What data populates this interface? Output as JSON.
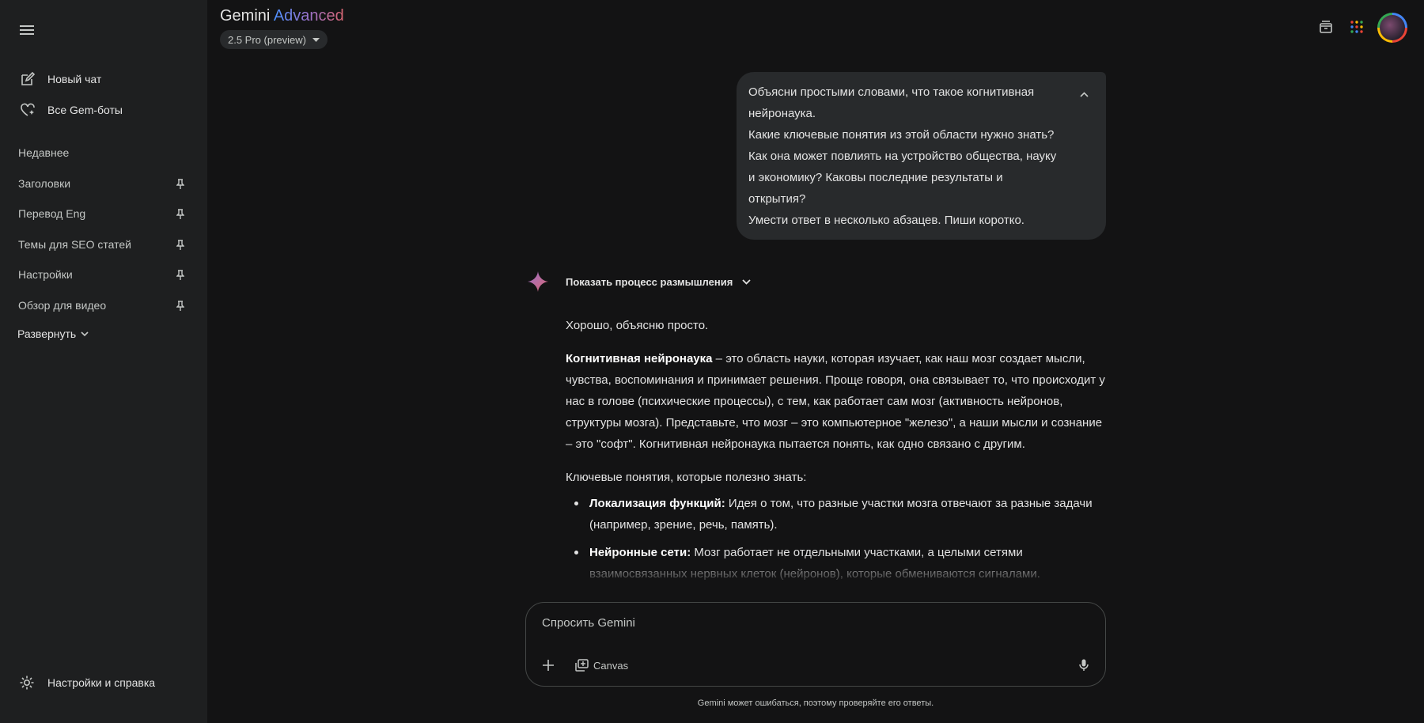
{
  "sidebar": {
    "new_chat": "Новый чат",
    "gems": "Все Gem-боты",
    "recent_label": "Недавнее",
    "recent_items": [
      {
        "label": "Заголовки"
      },
      {
        "label": "Перевод Eng"
      },
      {
        "label": "Темы для SEO статей"
      },
      {
        "label": "Настройки"
      },
      {
        "label": "Обзор для видео"
      }
    ],
    "expand": "Развернуть",
    "settings": "Настройки и справка"
  },
  "header": {
    "brand_main": "Gemini",
    "brand_tier": "Advanced",
    "model": "2.5 Pro (preview)"
  },
  "user_message": {
    "lines": [
      "Объясни простыми словами, что такое когнитивная нейронаука.",
      "Какие ключевые понятия из этой области нужно знать? Как она может повлиять на устройство общества, науку и экономику? Каковы последние результаты и открытия?",
      "Умести ответ в несколько абзацев. Пиши коротко."
    ]
  },
  "response": {
    "thinking_toggle": "Показать процесс размышления",
    "intro": "Хорошо, объясню просто.",
    "def_term": "Когнитивная нейронаука",
    "def_text": " – это область науки, которая изучает, как наш мозг создает мысли, чувства, воспоминания и принимает решения. Проще говоря, она связывает то, что происходит у нас в голове (психические процессы), с тем, как работает сам мозг (активность нейронов, структуры мозга). Представьте, что мозг – это компьютерное \"железо\", а наши мысли и сознание – это \"софт\". Когнитивная нейронаука пытается понять, как одно связано с другим.",
    "concepts_heading": "Ключевые понятия, которые полезно знать:",
    "concepts": [
      {
        "term": "Локализация функций:",
        "text": " Идея о том, что разные участки мозга отвечают за разные задачи (например, зрение, речь, память)."
      },
      {
        "term": "Нейронные сети:",
        "text": " Мозг работает не отдельными участками, а целыми сетями взаимосвязанных нервных клеток (нейронов), которые обмениваются сигналами."
      }
    ]
  },
  "composer": {
    "placeholder": "Спросить Gemini",
    "canvas": "Canvas",
    "disclaimer": "Gemini может ошибаться, поэтому проверяйте его ответы."
  },
  "colors": {
    "background": "#131314",
    "sidebar": "#1e1f20",
    "bubble": "#282a2c",
    "spark": "#d96570"
  },
  "icons": [
    "menu-icon",
    "new-chat-icon",
    "gem-icon",
    "pin-icon",
    "chevron-down-icon",
    "settings-icon",
    "archive-icon",
    "apps-grid-icon",
    "chevron-up-icon",
    "spark-icon",
    "plus-icon",
    "canvas-icon",
    "mic-icon"
  ]
}
